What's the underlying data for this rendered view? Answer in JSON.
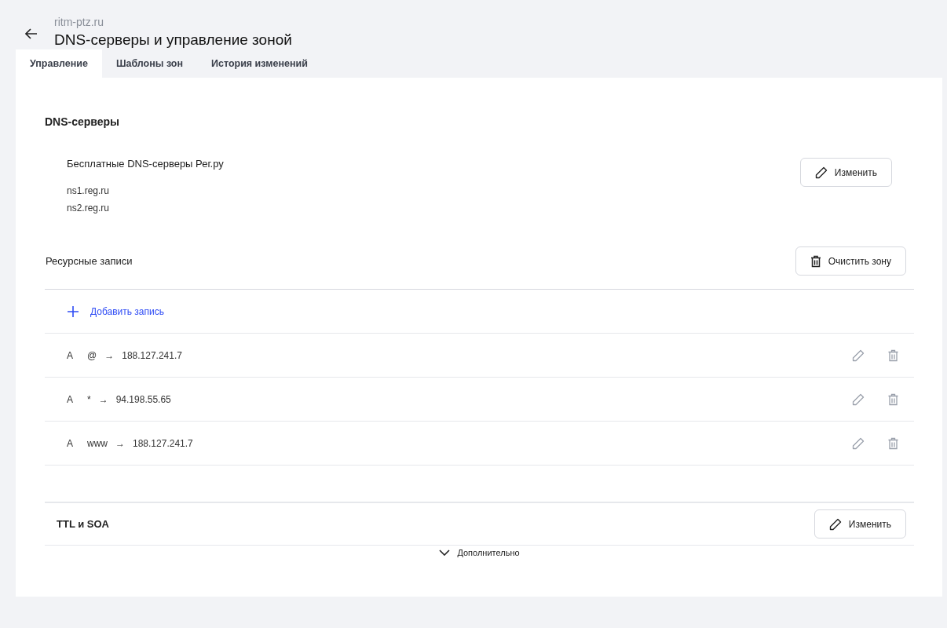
{
  "header": {
    "domain": "ritm-ptz.ru",
    "title": "DNS-серверы и управление зоной"
  },
  "tabs": [
    {
      "label": "Управление",
      "selected": true
    },
    {
      "label": "Шаблоны зон",
      "selected": false
    },
    {
      "label": "История изменений",
      "selected": false
    }
  ],
  "dns_servers": {
    "heading": "DNS-серверы",
    "name": "Бесплатные DNS-серверы Рег.ру",
    "servers": [
      "ns1.reg.ru",
      "ns2.reg.ru"
    ],
    "edit_button": "Изменить"
  },
  "resource_records": {
    "heading": "Ресурсные записи",
    "clear_button": "Очистить зону",
    "add_link": "Добавить запись",
    "records": [
      {
        "type": "A",
        "host": "@",
        "arrow": "→",
        "value": "188.127.241.7"
      },
      {
        "type": "A",
        "host": "*",
        "arrow": "→",
        "value": "94.198.55.65"
      },
      {
        "type": "A",
        "host": "www",
        "arrow": "→",
        "value": "188.127.241.7"
      }
    ]
  },
  "ttl_soa": {
    "heading": "TTL и SOA",
    "edit_button": "Изменить",
    "more_link": "Дополнительно"
  }
}
